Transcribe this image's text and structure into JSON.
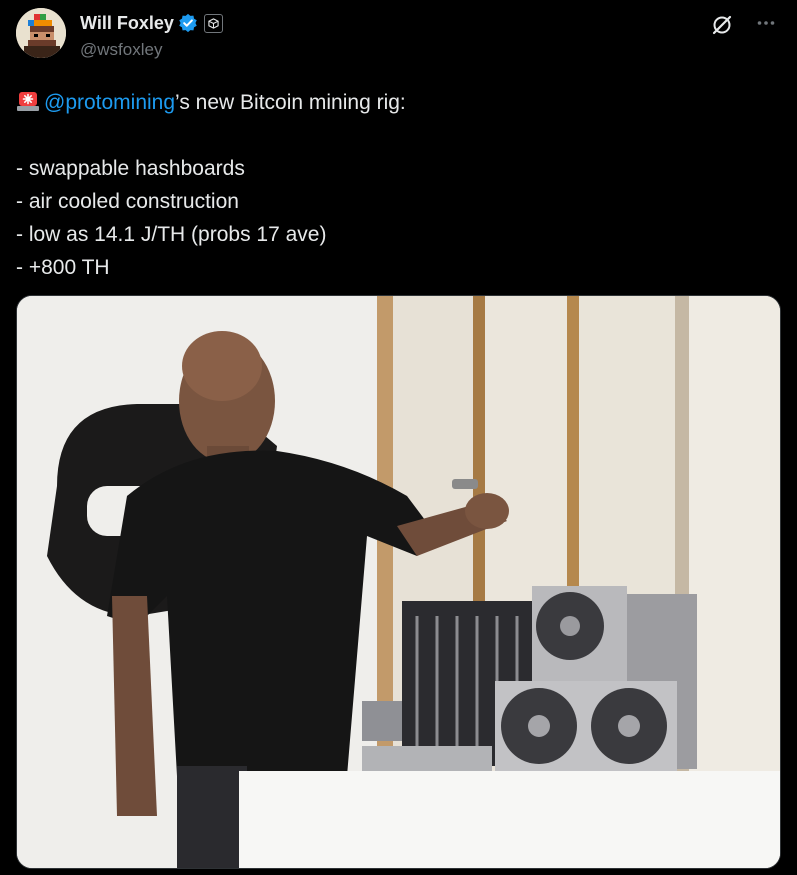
{
  "author": {
    "display_name": "Will Foxley",
    "handle": "@wsfoxley",
    "verified": true,
    "avatar_icon": "pixel-art-avatar-icon",
    "affiliation_icon": "organization-badge-icon"
  },
  "actions": {
    "grok_icon": "grok-icon",
    "more_icon": "more-options-icon"
  },
  "post": {
    "emoji_icon": "rotating-light-icon",
    "mention": "@protomining",
    "line1_rest": "’s new Bitcoin mining rig:",
    "bullets": [
      "- swappable hashboards",
      "- air cooled construction",
      "- low as 14.1 J/TH (probs 17 ave)",
      "- +800 TH"
    ]
  },
  "media": {
    "type": "photo"
  },
  "colors": {
    "background": "#000000",
    "text": "#e7e9ea",
    "secondary": "#71767b",
    "link": "#1d9bf0",
    "verified": "#1d9bf0"
  }
}
